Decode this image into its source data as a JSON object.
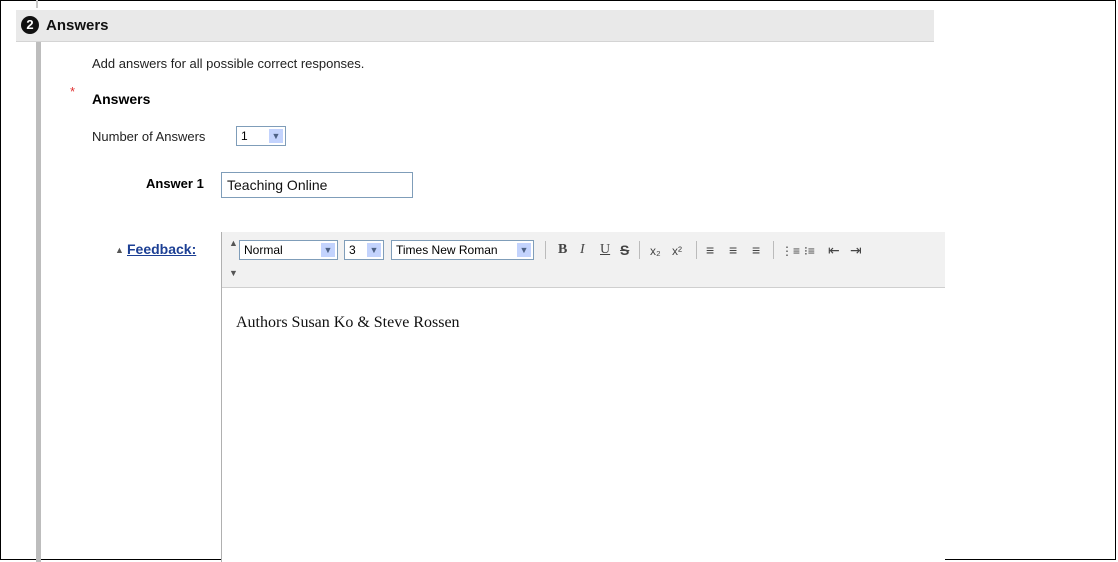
{
  "section": {
    "step_number": "2",
    "title": "Answers",
    "instructions": "Add answers for all possible correct responses.",
    "required_marker": "*",
    "answers_label": "Answers"
  },
  "number_of_answers": {
    "label": "Number of Answers",
    "selected": "1"
  },
  "answer1": {
    "label": "Answer 1",
    "value": "Teaching Online"
  },
  "feedback": {
    "link_label": "Feedback:",
    "toolbar": {
      "format_selected": "Normal",
      "size_selected": "3",
      "font_selected": "Times New Roman",
      "bold": "B",
      "italic": "I",
      "underline": "U",
      "strikethrough": "S",
      "subscript": "x₂",
      "superscript": "x²",
      "align_left": "≡",
      "align_center": "≡",
      "align_right": "≡",
      "numbered_list": "⋮≡",
      "bulleted_list": "⁝≡",
      "outdent": "⇤",
      "indent": "⇥"
    },
    "body_text": "Authors Susan Ko & Steve Rossen"
  }
}
